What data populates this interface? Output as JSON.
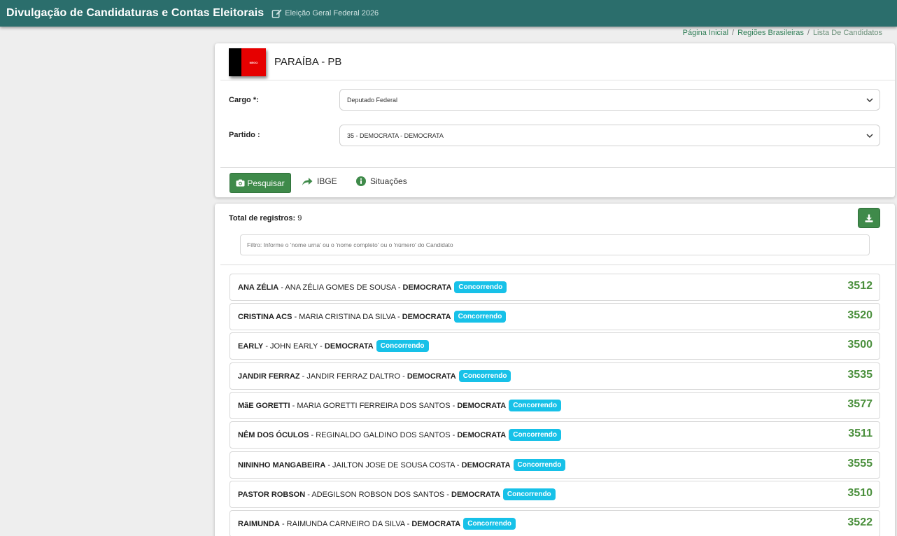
{
  "header": {
    "title": "Divulgação de Candidaturas e Contas Eleitorais",
    "election": "Eleição Geral Federal 2026"
  },
  "breadcrumb": {
    "home": "Página Inicial",
    "regions": "Regiões Brasileiras",
    "current": "Lista De Candidatos",
    "separator": "/"
  },
  "state": {
    "name": "PARAÍBA - PB",
    "flag_text": "NEGO",
    "flag_colors": [
      "#000000",
      "#e60000"
    ]
  },
  "form": {
    "cargo_label": "Cargo *:",
    "cargo_value": "Deputado Federal",
    "partido_label": "Partido :",
    "partido_value": "35 - DEMOCRATA - DEMOCRATA"
  },
  "actions": {
    "search_label": "Pesquisar",
    "ibge_label": "IBGE",
    "situacoes_label": "Situações"
  },
  "results": {
    "total_label": "Total de registros:",
    "total_value": "9",
    "filter_placeholder": "Filtro: Informe o 'nome urna' ou o 'nome completo' ou o 'número' do Candidato"
  },
  "colors": {
    "topbar": "#2b6e6c",
    "primary_button": "#3f8a4a",
    "badge": "#17c1e8",
    "number": "#4a8f3c"
  },
  "candidates": [
    {
      "urna": "ANA ZÉLIA",
      "full": " - ANA ZÉLIA GOMES DE SOUSA - ",
      "party": "DEMOCRATA",
      "status": "Concorrendo",
      "number": "3512"
    },
    {
      "urna": "CRISTINA ACS",
      "full": " - MARIA CRISTINA DA SILVA - ",
      "party": "DEMOCRATA",
      "status": "Concorrendo",
      "number": "3520"
    },
    {
      "urna": "EARLY",
      "full": " - JOHN EARLY - ",
      "party": "DEMOCRATA",
      "status": "Concorrendo",
      "number": "3500"
    },
    {
      "urna": "JANDIR FERRAZ",
      "full": " - JANDIR FERRAZ DALTRO - ",
      "party": "DEMOCRATA",
      "status": "Concorrendo",
      "number": "3535"
    },
    {
      "urna": "MãE GORETTI",
      "full": " - MARIA GORETTI FERREIRA DOS SANTOS - ",
      "party": "DEMOCRATA",
      "status": "Concorrendo",
      "number": "3577"
    },
    {
      "urna": "NÊM DOS ÓCULOS",
      "full": " - REGINALDO GALDINO DOS SANTOS - ",
      "party": "DEMOCRATA",
      "status": "Concorrendo",
      "number": "3511"
    },
    {
      "urna": "NININHO MANGABEIRA",
      "full": " - JAILTON JOSE DE SOUSA COSTA - ",
      "party": "DEMOCRATA",
      "status": "Concorrendo",
      "number": "3555"
    },
    {
      "urna": "PASTOR ROBSON",
      "full": " - ADEGILSON ROBSON DOS SANTOS - ",
      "party": "DEMOCRATA",
      "status": "Concorrendo",
      "number": "3510"
    },
    {
      "urna": "RAIMUNDA",
      "full": " - RAIMUNDA CARNEIRO DA SILVA - ",
      "party": "DEMOCRATA",
      "status": "Concorrendo",
      "number": "3522"
    }
  ]
}
